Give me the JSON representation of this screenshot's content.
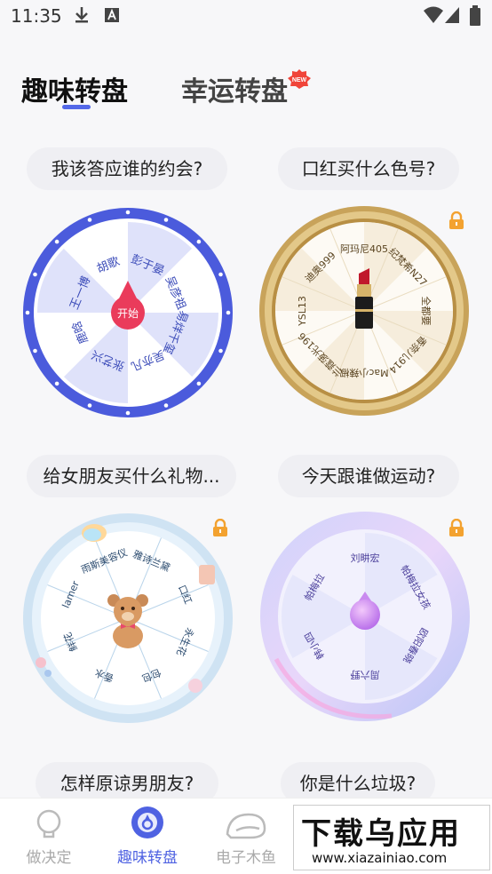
{
  "status_bar": {
    "time": "11:35"
  },
  "top_tabs": [
    {
      "label": "趣味转盘",
      "active": true
    },
    {
      "label": "幸运转盘",
      "active": false,
      "badge": "NEW"
    }
  ],
  "cards": [
    {
      "question": "我该答应谁的约会?",
      "locked": false,
      "center_label": "开始",
      "segments": [
        "胡歌",
        "彭于晏",
        "吴彦祖",
        "易烊千玺",
        "吴亦凡",
        "张艺兴",
        "鹿晗",
        "王一博"
      ]
    },
    {
      "question": "口红买什么色号?",
      "locked": true,
      "segments": [
        "阿玛尼405",
        "纪梵希N27",
        "全都要",
        "香奈儿914",
        "Mac小辣椒",
        "兰蔻菠光196",
        "YSL13",
        "迪奥999"
      ]
    },
    {
      "question": "给女朋友买什么礼物...",
      "locked": true,
      "segments": [
        "雅诗兰黛",
        "口红",
        "永生花",
        "包包",
        "香水",
        "鲜花",
        "lamer",
        "雨斯美容仪"
      ]
    },
    {
      "question": "今天跟谁做运动?",
      "locked": true,
      "segments": [
        "刘畊宏",
        "帕梅拉",
        "韩小四",
        "周六野",
        "欧阳春晓",
        "帕梅拉女孩"
      ]
    },
    {
      "question": "怎样原谅男朋友?"
    },
    {
      "question": "你是什么垃圾?"
    }
  ],
  "bottom_nav": [
    {
      "label": "做决定",
      "icon": "bulb-icon",
      "active": false
    },
    {
      "label": "趣味转盘",
      "icon": "wheel-icon",
      "active": true
    },
    {
      "label": "电子木鱼",
      "icon": "woodfish-icon",
      "active": false
    }
  ],
  "watermark": {
    "main": "下载乌应用",
    "sub": "www.xiazainiao.com"
  },
  "colors": {
    "accent": "#4f62e2",
    "gold": "#c8a35a",
    "lock": "#f3a230"
  }
}
